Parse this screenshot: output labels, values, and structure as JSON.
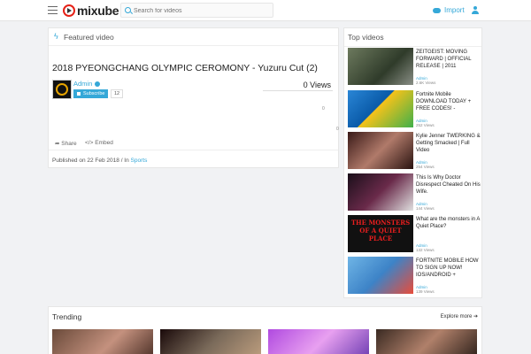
{
  "header": {
    "logo_text": "mixube",
    "search_placeholder": "Search for videos",
    "import_label": "Import"
  },
  "featured": {
    "section_label": "Featured video",
    "title": "2018 PYEONGCHANG OLYMPIC CEROMONY - Yuzuru Cut (2)",
    "author": "Admin",
    "subscribe_label": "Subscribe",
    "subscriber_count": "12",
    "views": "0 Views",
    "likes": "0",
    "dislikes": "0",
    "share_label": "Share",
    "embed_label": "Embed",
    "published_prefix": "Published on 22 Feb 2018 / In",
    "category": "Sports"
  },
  "top_videos": {
    "label": "Top videos",
    "items": [
      {
        "title": "ZEITGEIST: MOVING FORWARD | OFFICIAL RELEASE | 2011",
        "author": "Admin",
        "views": "2.6K Views"
      },
      {
        "title": "Fortnite Mobile DOWNLOAD TODAY + FREE CODES! -",
        "author": "Admin",
        "views": "252 Views"
      },
      {
        "title": "Kylie Jenner TWERKING & Getting Smacked | Full Video",
        "author": "Admin",
        "views": "254 Views"
      },
      {
        "title": "This Is Why Doctor Disrespect Cheated On His Wife.",
        "author": "Admin",
        "views": "144 Views"
      },
      {
        "title": "What are the monsters in A Quiet Place?",
        "author": "Admin",
        "views": "132 Views",
        "thumb_text": "THE MONSTERS OF A QUIET PLACE"
      },
      {
        "title": "FORTNITE MOBILE HOW TO SIGN UP NOW! IOS/ANDROID +",
        "author": "Admin",
        "views": "139 Views"
      }
    ]
  },
  "trending": {
    "label": "Trending",
    "explore_label": "Explore more ➔"
  },
  "colors": {
    "accent": "#35a8d8",
    "background": "#f1f2f4"
  }
}
